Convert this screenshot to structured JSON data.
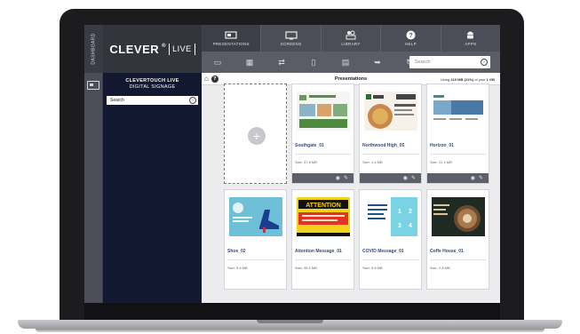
{
  "sidebar": {
    "dashboard_label": "DASHBOARD"
  },
  "logo": {
    "brand": "CLEVER",
    "reg": "®",
    "live": "LIVE"
  },
  "nav": {
    "items": [
      {
        "label": "PRESENTATIONS",
        "icon": "presentation-icon"
      },
      {
        "label": "SCREENS",
        "icon": "monitor-icon"
      },
      {
        "label": "LIBRARY",
        "icon": "library-icon"
      },
      {
        "label": "HELP",
        "icon": "help-icon"
      },
      {
        "label": "APPS",
        "icon": "android-icon"
      }
    ]
  },
  "toolbar": {
    "search_placeholder": "Search"
  },
  "left_panel": {
    "title": "CLEVERTOUCH LIVE",
    "subtitle": "DIGITAL SIGNAGE",
    "search_placeholder": "Search"
  },
  "breadcrumb": {
    "title": "Presentations",
    "usage_prefix": "Using",
    "usage_used": "210 MB (21%)",
    "usage_mid": "of your",
    "usage_total": "1 GB"
  },
  "presentations": [
    {
      "name": "Southgate_01",
      "size": "Size: 37.8 MB"
    },
    {
      "name": "Northwood High_05",
      "size": "Size: 1.4 MB"
    },
    {
      "name": "Horizon_01",
      "size": "Size: 22.1 MB"
    },
    {
      "name": "Shoe_02",
      "size": "Size: 5.6 MB"
    },
    {
      "name": "Attention Message_01",
      "size": "Size: 38.1 MB"
    },
    {
      "name": "COVID Message_01",
      "size": "Size: 9.8 MB"
    },
    {
      "name": "Coffe House_01",
      "size": "Size: 2.8 MB"
    }
  ],
  "thumb_text": {
    "attention": "ATTENTION",
    "covid_numbers": [
      "1",
      "2",
      "3",
      "4"
    ]
  },
  "colors": {
    "sidebar_dark": "#11182f",
    "nav_bg": "#4b4e57",
    "name_blue": "#3b4c7a",
    "attention_yellow": "#f4d11a"
  }
}
